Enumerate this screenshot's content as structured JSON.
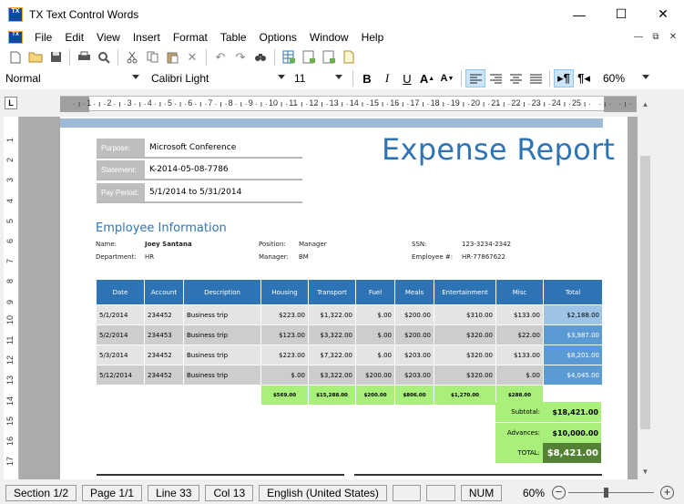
{
  "window": {
    "title": "TX Text Control Words",
    "minimize": "—",
    "maximize": "☐",
    "close": "✕"
  },
  "app_icon": "TX",
  "menu": [
    "File",
    "Edit",
    "View",
    "Insert",
    "Format",
    "Table",
    "Options",
    "Window",
    "Help"
  ],
  "mdi_controls": [
    "—",
    "⧉",
    "✕"
  ],
  "toolbar_icons": [
    "new-document-icon",
    "open-folder-icon",
    "save-icon",
    "print-icon",
    "print-preview-icon",
    "cut-icon",
    "copy-icon",
    "paste-icon",
    "delete-icon",
    "undo-icon",
    "redo-icon",
    "find-icon",
    "table-icon-1",
    "table-icon-2",
    "table-icon-3",
    "table-icon-4"
  ],
  "format": {
    "style": "Normal",
    "font": "Calibri Light",
    "size": "11",
    "zoom": "60%",
    "bold": "B",
    "italic": "I",
    "underline": "U",
    "grow": "A",
    "shrink": "A"
  },
  "ruler_labels": [
    "1",
    "2",
    "3",
    "4",
    "5",
    "6",
    "7",
    "8",
    "9",
    "10",
    "11",
    "12",
    "13",
    "14",
    "15",
    "16",
    "17",
    "18",
    "19",
    "20",
    "21",
    "22",
    "23",
    "24",
    "25"
  ],
  "vruler_labels": [
    "1",
    "2",
    "3",
    "4",
    "5",
    "6",
    "7",
    "8",
    "9",
    "10",
    "11",
    "12",
    "13",
    "14",
    "15",
    "16",
    "17"
  ],
  "ruler_corner": "L",
  "report": {
    "title": "Expense Report",
    "purpose_label": "Purpose:",
    "purpose": "Microsoft Conference",
    "statement_label": "Statement:",
    "statement": "K-2014-05-08-7786",
    "period_label": "Pay Period:",
    "period": "5/1/2014 to 5/31/2014",
    "emp_heading": "Employee Information",
    "name_label": "Name:",
    "name": "Joey Santana",
    "position_label": "Position:",
    "position": "Manager",
    "ssn_label": "SSN:",
    "ssn": "123-3234-2342",
    "dept_label": "Department:",
    "dept": "HR",
    "manager_label": "Manager:",
    "manager": "BM",
    "empnum_label": "Employee #:",
    "empnum": "HR-77867622"
  },
  "table": {
    "headers": [
      "Date",
      "Account",
      "Description",
      "Housing",
      "Transport",
      "Fuel",
      "Meals",
      "Entertainment",
      "Misc",
      "Total"
    ],
    "rows": [
      [
        "5/1/2014",
        "234452",
        "Business trip",
        "$223.00",
        "$1,322.00",
        "$.00",
        "$200.00",
        "$310.00",
        "$133.00",
        "$2,188.00"
      ],
      [
        "5/2/2014",
        "234453",
        "Business trip",
        "$123.00",
        "$3,322.00",
        "$.00",
        "$200.00",
        "$320.00",
        "$22.00",
        "$3,987.00"
      ],
      [
        "5/3/2014",
        "234452",
        "Business trip",
        "$223.00",
        "$7,322.00",
        "$.00",
        "$203.00",
        "$320.00",
        "$133.00",
        "$8,201.00"
      ],
      [
        "5/12/2014",
        "234452",
        "Business trip",
        "$.00",
        "$3,322.00",
        "$200.00",
        "$203.00",
        "$320.00",
        "$.00",
        "$4,045.00"
      ]
    ],
    "sums": [
      "$569.00",
      "$15,288.00",
      "$200.00",
      "$806.00",
      "$1,270.00",
      "$288.00"
    ],
    "subtotal_label": "Subtotal:",
    "subtotal": "$18,421.00",
    "advances_label": "Advances:",
    "advances": "$10,000.00",
    "total_label": "TOTAL:",
    "total": "$8,421.00"
  },
  "status": {
    "section": "Section 1/2",
    "page": "Page 1/1",
    "line": "Line 33",
    "col": "Col 13",
    "language": "English (United States)",
    "num": "NUM",
    "zoom": "60%",
    "zoom_minus": "−",
    "zoom_plus": "+"
  }
}
